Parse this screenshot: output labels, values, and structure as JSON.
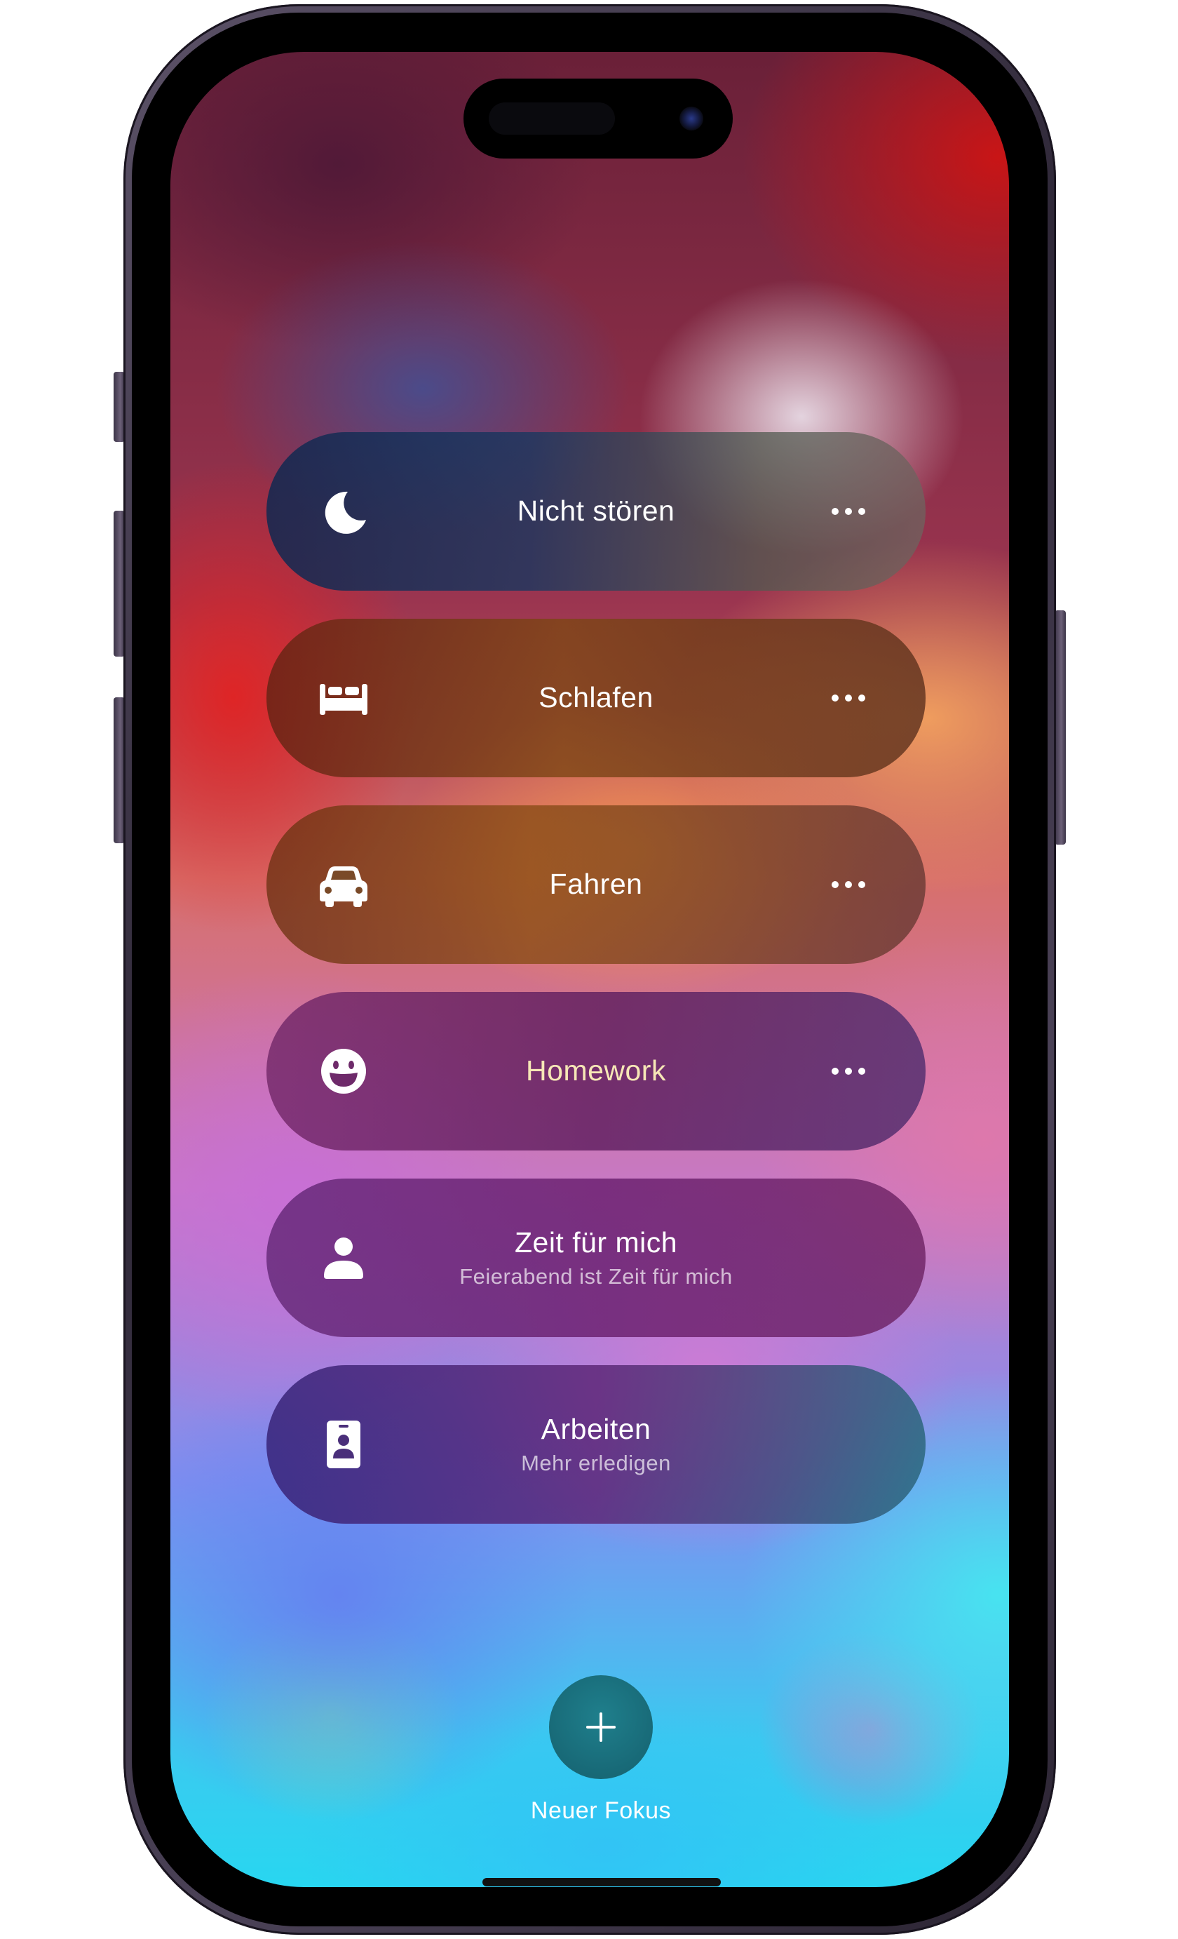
{
  "focus_modes": [
    {
      "label": "Nicht stören",
      "subtitle": "",
      "icon": "moon-icon",
      "has_more": true
    },
    {
      "label": "Schlafen",
      "subtitle": "",
      "icon": "bed-icon",
      "has_more": true
    },
    {
      "label": "Fahren",
      "subtitle": "",
      "icon": "car-icon",
      "has_more": true
    },
    {
      "label": "Homework",
      "subtitle": "",
      "icon": "smiley-icon",
      "has_more": true,
      "label_color": "#f6e7b6"
    },
    {
      "label": "Zeit für mich",
      "subtitle": "Feierabend ist Zeit für mich",
      "icon": "person-icon",
      "has_more": false
    },
    {
      "label": "Arbeiten",
      "subtitle": "Mehr erledigen",
      "icon": "id-badge-icon",
      "has_more": false
    }
  ],
  "new_focus": {
    "label": "Neuer Fokus",
    "icon": "plus-icon",
    "button_color": "#1a6f7d"
  },
  "more_icon": "ellipsis-icon",
  "colors": {
    "text": "#ffffff",
    "homework_label": "#f6e7b6"
  }
}
